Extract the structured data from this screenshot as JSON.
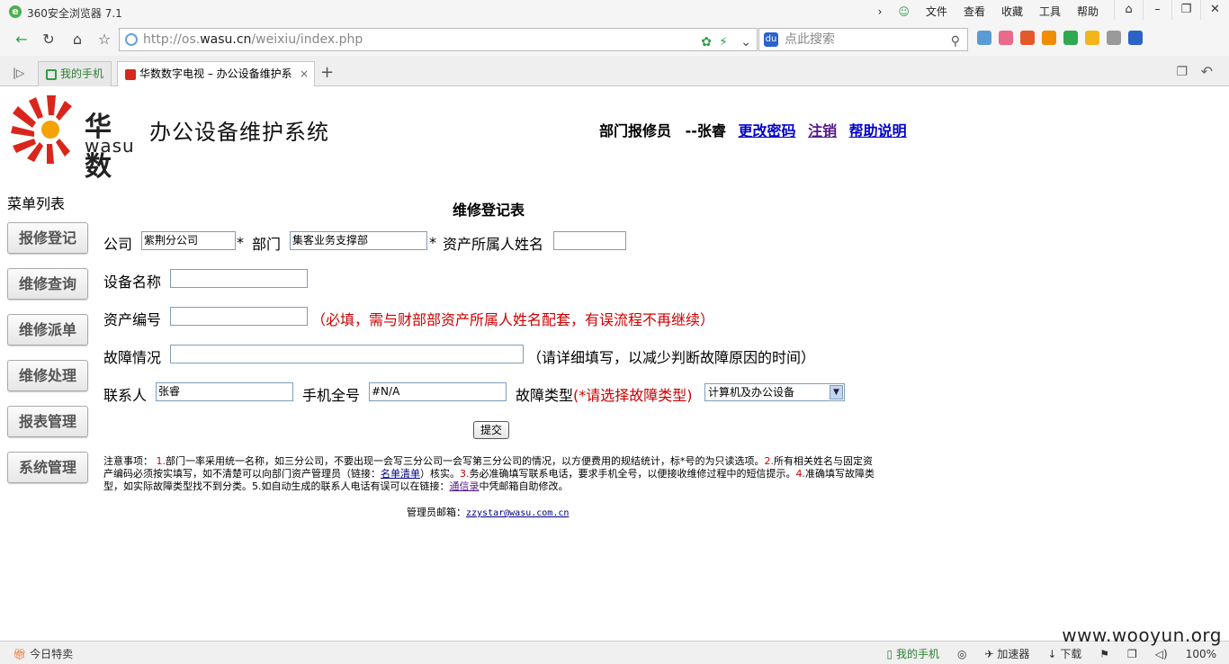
{
  "browser": {
    "app_title": "360安全浏览器 7.1",
    "menu": [
      "文件",
      "查看",
      "收藏",
      "工具",
      "帮助"
    ],
    "url_prefix": "http://os.",
    "url_domain": "wasu.cn",
    "url_path": "/weixiu/index.php",
    "search_placeholder": "点此搜索",
    "tabs": [
      {
        "label": "我的手机"
      },
      {
        "label": "华数数字电视 – 办公设备维护系"
      }
    ],
    "status_left": "今日特卖",
    "status_items": [
      "我的手机",
      "加速器",
      "下载"
    ],
    "zoom": "100%"
  },
  "header": {
    "brand_cn": "华数",
    "brand_en": "wasu",
    "system_title": "办公设备维护系统",
    "user_role": "部门报修员",
    "user_name": "--张睿",
    "links": {
      "change_password": "更改密码",
      "logout": "注销",
      "help": "帮助说明"
    }
  },
  "sidebar": {
    "title": "菜单列表",
    "items": [
      "报修登记",
      "维修查询",
      "维修派单",
      "维修处理",
      "报表管理",
      "系统管理"
    ]
  },
  "form": {
    "title": "维修登记表",
    "company_label": "公司",
    "company_value": "紫荆分公司",
    "dept_label": "部门",
    "dept_value": "集客业务支撑部",
    "owner_label": "资产所属人姓名",
    "owner_value": "",
    "required_mark": "*",
    "device_label": "设备名称",
    "device_value": "",
    "asset_label": "资产编号",
    "asset_value": "",
    "asset_hint": "（必填，需与财部部资产所属人姓名配套，有误流程不再继续）",
    "fault_label": "故障情况",
    "fault_value": "",
    "fault_hint": "（请详细填写，以减少判断故障原因的时间）",
    "contact_label": "联系人",
    "contact_value": "张睿",
    "phone_label": "手机全号",
    "phone_value": "#N/A",
    "type_label": "故障类型",
    "type_hint": "(*请选择故障类型)",
    "type_selected": "计算机及办公设备",
    "submit_label": "提交"
  },
  "notes": {
    "prefix": "注意事项：",
    "n1": "1.",
    "t1": "部门一率采用统一名称，如三分公司，不要出现一会写三分公司一会写第三分公司的情况，以方便费用的规结统计，标*号的为只读选项。",
    "n2": "2.",
    "t2a": "所有相关姓名与固定资产编码必须按实填写，如不清楚可以向部门资产管理员（链接：",
    "link1": "名单清单",
    "t2b": "）核实。",
    "n3": "3.",
    "t3": "务必准确填写联系电话，要求手机全号，以便接收维修过程中的短信提示。",
    "n4": "4.",
    "t4": "准确填写故障类型，如实际故障类型找不到分类。",
    "n5": "5.",
    "t5a": "如自动生成的联系人电话有误可以在链接：",
    "link2": "通信录",
    "t5b": "中凭邮箱自助修改。"
  },
  "admin": {
    "label": "管理员邮箱：",
    "email": "zzystar@wasu.com.cn"
  },
  "watermark": "www.wooyun.org",
  "colors": {
    "accent_red": "#cc0000",
    "link_blue": "#0000cc",
    "logo_red": "#d9261c",
    "logo_orange": "#f5a300"
  }
}
